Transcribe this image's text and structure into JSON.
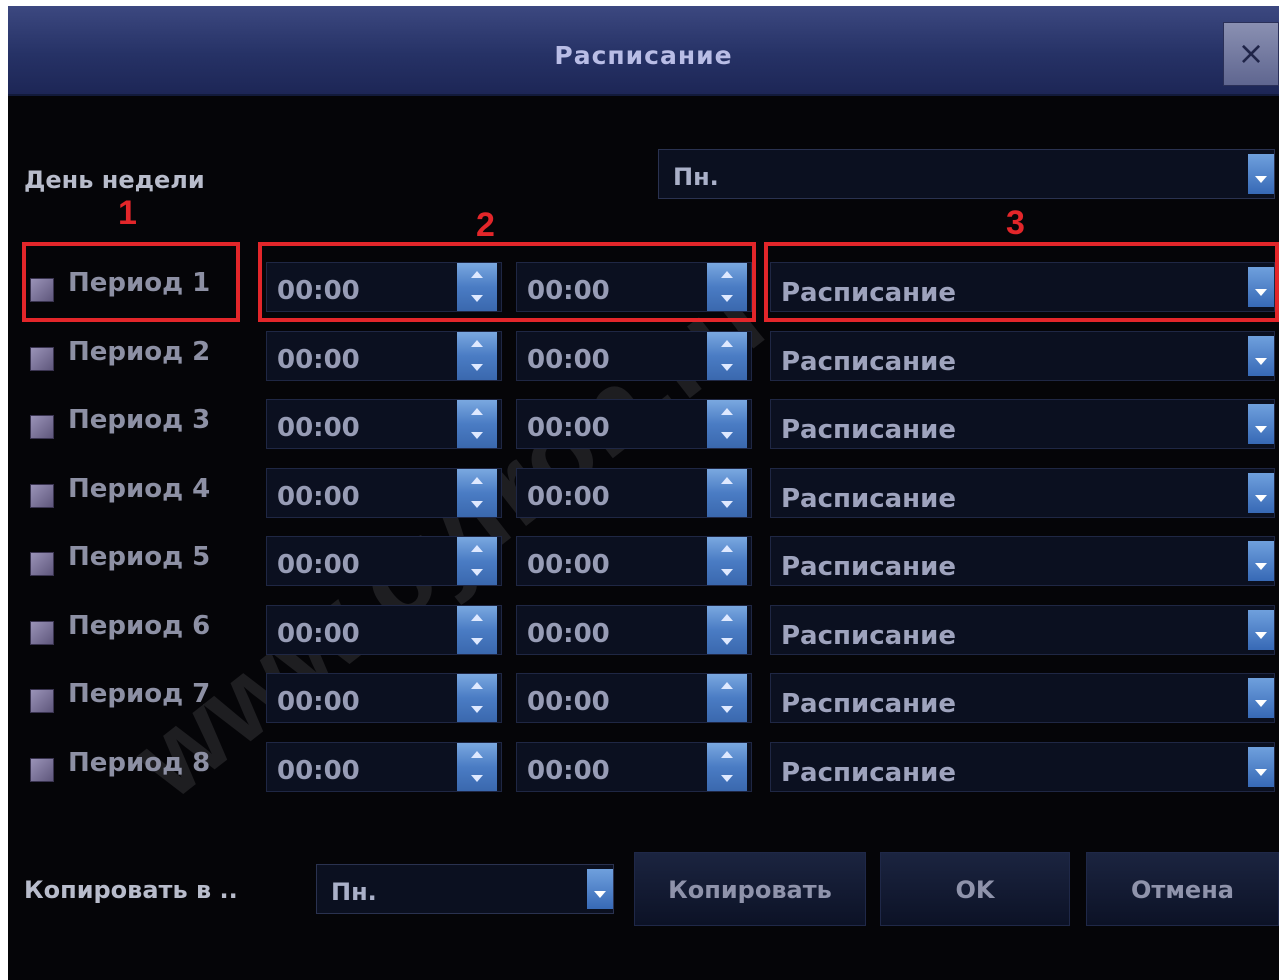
{
  "window": {
    "title": "Расписание",
    "close_label": "×"
  },
  "weekday": {
    "label": "День недели",
    "value": "Пн."
  },
  "annotations": [
    "1",
    "2",
    "3"
  ],
  "periods": [
    {
      "label": "Период 1",
      "start": "00:00",
      "end": "00:00",
      "mode": "Расписание"
    },
    {
      "label": "Период 2",
      "start": "00:00",
      "end": "00:00",
      "mode": "Расписание"
    },
    {
      "label": "Период 3",
      "start": "00:00",
      "end": "00:00",
      "mode": "Расписание"
    },
    {
      "label": "Период 4",
      "start": "00:00",
      "end": "00:00",
      "mode": "Расписание"
    },
    {
      "label": "Период 5",
      "start": "00:00",
      "end": "00:00",
      "mode": "Расписание"
    },
    {
      "label": "Период 6",
      "start": "00:00",
      "end": "00:00",
      "mode": "Расписание"
    },
    {
      "label": "Период 7",
      "start": "00:00",
      "end": "00:00",
      "mode": "Расписание"
    },
    {
      "label": "Период 8",
      "start": "00:00",
      "end": "00:00",
      "mode": "Расписание"
    }
  ],
  "copy": {
    "label": "Копировать в ..",
    "value": "Пн."
  },
  "buttons": {
    "copy": "Копировать",
    "ok": "OK",
    "cancel": "Отмена"
  },
  "watermark": "www.cyfron.ru",
  "colors": {
    "background": "#050508",
    "titlebar": "#263266",
    "accent": "#4a7cc4",
    "highlight": "#e3262a"
  }
}
